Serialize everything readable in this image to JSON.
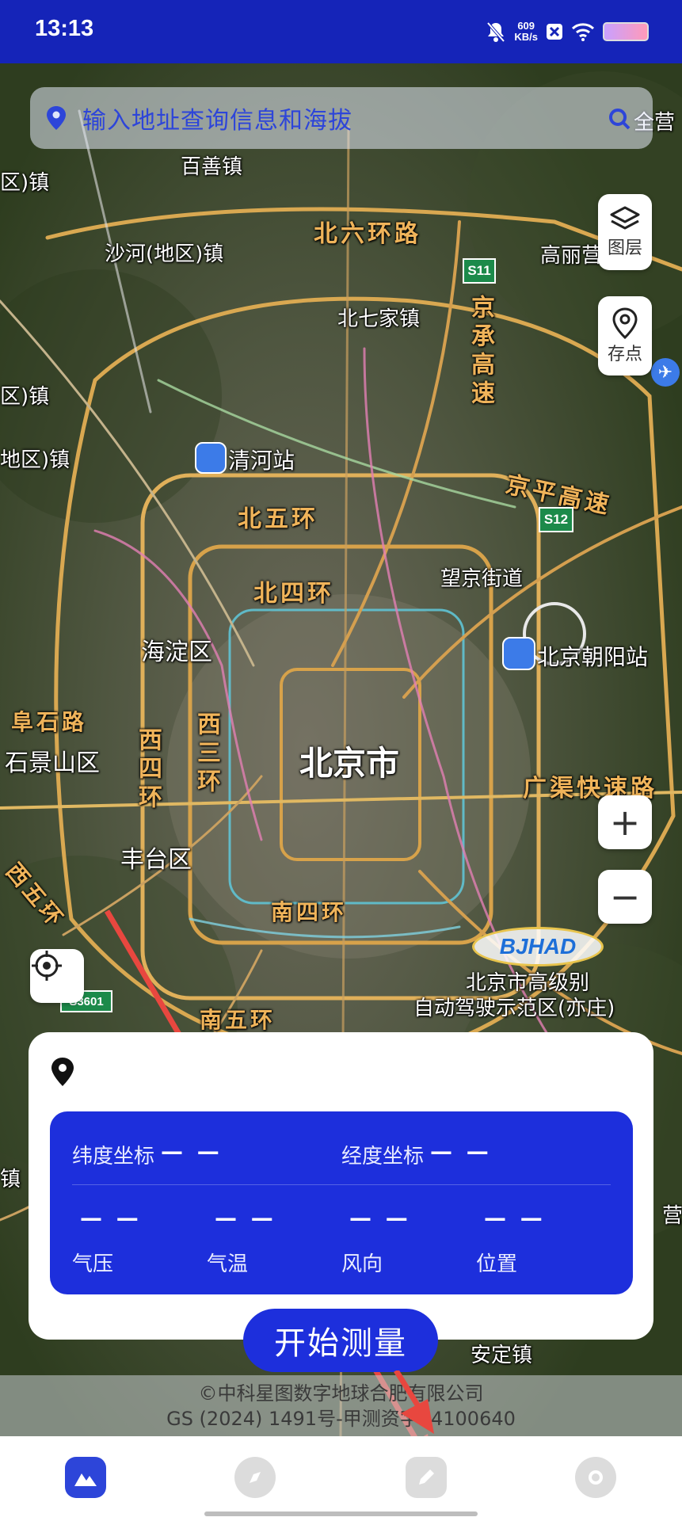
{
  "status_bar": {
    "time": "13:13",
    "net_speed_value": "609",
    "net_speed_unit": "KB/s",
    "icons": [
      "mute-bell-icon",
      "close-box-icon",
      "wifi-icon",
      "battery-icon"
    ]
  },
  "search": {
    "placeholder": "输入地址查询信息和海拔",
    "icon": "location-pin-icon"
  },
  "map_buttons": {
    "layers_label": "图层",
    "save_point_label": "存点",
    "zoom_in": "+",
    "zoom_out": "−"
  },
  "map_labels": {
    "baishan": "百善镇",
    "qu_zhen_1": "区)镇",
    "shahe": "沙河(地区)镇",
    "north_6th_ring": "北六环路",
    "s11": "S11",
    "gaoli": "高丽营",
    "beiqijia": "北七家镇",
    "jingcheng": "京承高速",
    "zhen_2": "区)镇",
    "zhen_3": "地区)镇",
    "qinghe_station": "清河站",
    "jingping": "京平高速",
    "north_5th_ring": "北五环",
    "s12": "S12",
    "wangjing": "望京街道",
    "north_4th_ring": "北四环",
    "haidian": "海淀区",
    "chaoyang_station": "北京朝阳站",
    "fushi_road": "阜石路",
    "west_4th_ring": "西四环",
    "west_3rd_ring": "西三环",
    "beijing": "北京市",
    "shijingshan": "石景山区",
    "guangqu": "广渠快速路",
    "west_5th_ring": "西五环",
    "fengtai": "丰台区",
    "south_4th_ring": "南四环",
    "bjhad_logo": "BJHAD",
    "bjhad_desc_1": "北京市高级别",
    "bjhad_desc_2": "自动驾驶示范区(亦庄)",
    "s3601": "S3601",
    "south_5th_ring": "南五环",
    "anding": "安定镇",
    "zhen_left": "镇",
    "ying_right": "营",
    "anquan": "全营"
  },
  "info_card": {
    "lat_label": "纬度坐标",
    "lat_value": "— —",
    "lon_label": "经度坐标",
    "lon_value": "— —",
    "pressure_value": "— —",
    "pressure_label": "气压",
    "temp_value": "— —",
    "temp_label": "气温",
    "wind_value": "— —",
    "wind_label": "风向",
    "pos_value": "— —",
    "pos_label": "位置"
  },
  "start_button": "开始测量",
  "copyright": {
    "line1": "©中科星图数字地球合肥有限公司",
    "line2": "GS (2024) 1491号-甲测资字34100640"
  },
  "bottom_nav": [
    "map-tab-icon",
    "compass-tab-icon",
    "edit-tab-icon",
    "settings-tab-icon"
  ],
  "colors": {
    "primary": "#1d2fdc",
    "status_bar": "#1524b8",
    "road_label": "#f0b45a",
    "annotation_arrow": "#e8473f"
  }
}
